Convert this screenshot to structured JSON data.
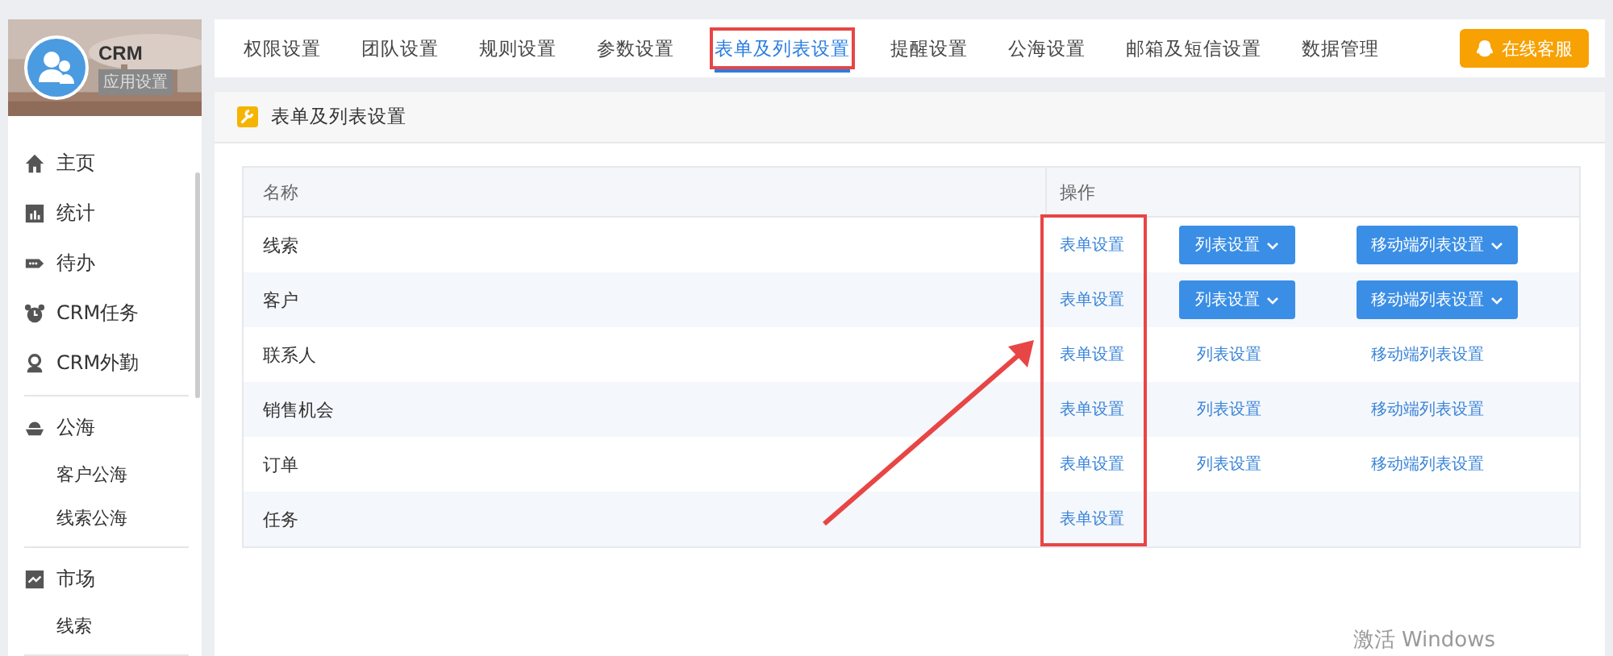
{
  "app": {
    "title": "CRM",
    "subtitle": "应用设置"
  },
  "sidebar": {
    "sections": [
      {
        "items": [
          {
            "label": "主页",
            "kind": "home"
          },
          {
            "label": "统计",
            "kind": "chart"
          },
          {
            "label": "待办",
            "kind": "tag"
          },
          {
            "label": "CRM任务",
            "kind": "alarm"
          },
          {
            "label": "CRM外勤",
            "kind": "person"
          }
        ]
      },
      {
        "items": [
          {
            "label": "公海",
            "kind": "ship",
            "children": [
              {
                "label": "客户公海"
              },
              {
                "label": "线索公海"
              }
            ]
          }
        ]
      },
      {
        "items": [
          {
            "label": "市场",
            "kind": "trend",
            "children": [
              {
                "label": "线索"
              }
            ]
          }
        ]
      }
    ]
  },
  "tabs": [
    {
      "label": "权限设置",
      "selected": false,
      "annotated": false
    },
    {
      "label": "团队设置",
      "selected": false,
      "annotated": false
    },
    {
      "label": "规则设置",
      "selected": false,
      "annotated": false
    },
    {
      "label": "参数设置",
      "selected": false,
      "annotated": false
    },
    {
      "label": "表单及列表设置",
      "selected": true,
      "annotated": true
    },
    {
      "label": "提醒设置",
      "selected": false,
      "annotated": false
    },
    {
      "label": "公海设置",
      "selected": false,
      "annotated": false
    },
    {
      "label": "邮箱及短信设置",
      "selected": false,
      "annotated": false
    },
    {
      "label": "数据管理",
      "selected": false,
      "annotated": false
    }
  ],
  "support_button": "在线客服",
  "panel": {
    "title": "表单及列表设置"
  },
  "table": {
    "columns": [
      "名称",
      "操作"
    ],
    "form_column_annotated": true,
    "rows": [
      {
        "name": "线索",
        "form": "表单设置",
        "list": {
          "label": "列表设置",
          "kind": "dropdown"
        },
        "mobile": {
          "label": "移动端列表设置",
          "kind": "dropdown"
        }
      },
      {
        "name": "客户",
        "form": "表单设置",
        "list": {
          "label": "列表设置",
          "kind": "dropdown"
        },
        "mobile": {
          "label": "移动端列表设置",
          "kind": "dropdown"
        }
      },
      {
        "name": "联系人",
        "form": "表单设置",
        "list": {
          "label": "列表设置",
          "kind": "link"
        },
        "mobile": {
          "label": "移动端列表设置",
          "kind": "link"
        }
      },
      {
        "name": "销售机会",
        "form": "表单设置",
        "list": {
          "label": "列表设置",
          "kind": "link"
        },
        "mobile": {
          "label": "移动端列表设置",
          "kind": "link"
        }
      },
      {
        "name": "订单",
        "form": "表单设置",
        "list": {
          "label": "列表设置",
          "kind": "link"
        },
        "mobile": {
          "label": "移动端列表设置",
          "kind": "link"
        }
      },
      {
        "name": "任务",
        "form": "表单设置"
      }
    ]
  },
  "os_notice": "激活 Windows"
}
